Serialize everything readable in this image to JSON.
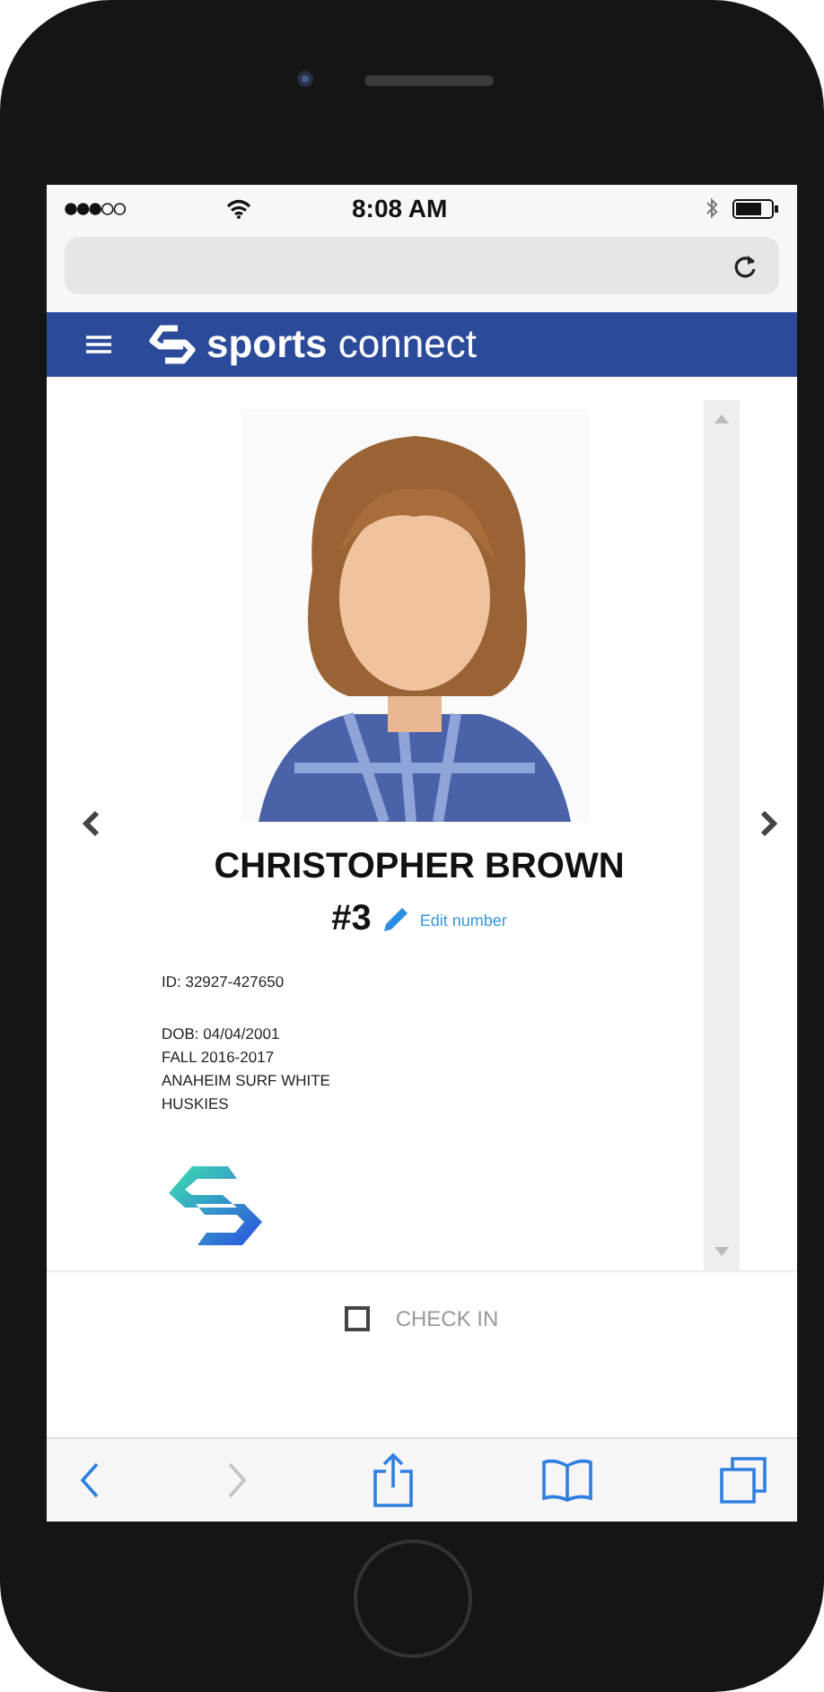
{
  "status_bar": {
    "time": "8:08 AM"
  },
  "app_bar": {
    "brand_bold": "sports",
    "brand_light": "connect"
  },
  "player": {
    "photo": {
      "kind": "picture"
    },
    "name": "CHRISTOPHER BROWN",
    "number": "#3",
    "edit_link": "Edit number",
    "id": "ID: 32927-427650",
    "details": [
      "DOB: 04/04/2001",
      "FALL 2016-2017",
      "ANAHEIM SURF WHITE",
      "HUSKIES"
    ]
  },
  "check_in": {
    "label": "CHECK IN",
    "checked": false
  },
  "toolbar": [
    {
      "kind": "back",
      "disabled": false
    },
    {
      "kind": "forward",
      "disabled": true
    },
    {
      "kind": "share",
      "disabled": false
    },
    {
      "kind": "bookmarks",
      "disabled": false
    },
    {
      "kind": "tabs",
      "disabled": false
    }
  ]
}
